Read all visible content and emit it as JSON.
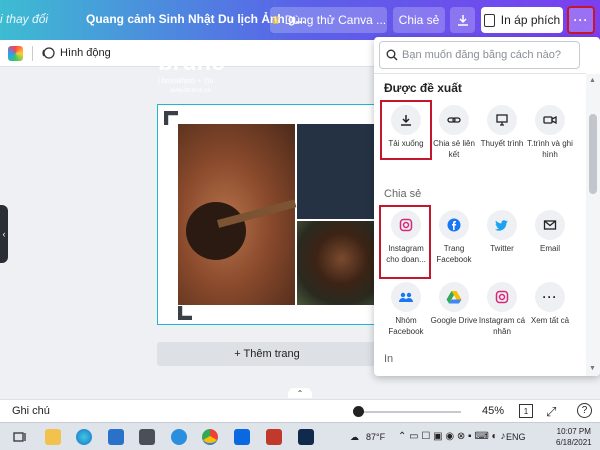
{
  "topbar": {
    "changes_text": "i thay đổi",
    "doc_title": "Quang cảnh Sinh Nhật Du lịch Ảnh g...",
    "trial_label": "Dùng thử Canva ...",
    "share_label": "Chia sẻ",
    "print_label": "In áp phích",
    "more_label": "···"
  },
  "toolbar": {
    "animate_label": "Hình động"
  },
  "design": {
    "brunch_title": "brunc",
    "brunch_sub": "[ br(eakfast) + (l)u",
    "brunch_url": "www.brunch.co"
  },
  "canvas": {
    "add_page_label": "+ Thêm trang"
  },
  "share_panel": {
    "search_placeholder": "Bạn muốn đăng bằng cách nào?",
    "suggested_title": "Được đề xuất",
    "suggested": [
      {
        "label": "Tải xuống",
        "icon": "download-icon"
      },
      {
        "label": "Chia sẻ liên kết",
        "icon": "link-icon"
      },
      {
        "label": "Thuyết trình",
        "icon": "present-icon"
      },
      {
        "label": "T.trình và ghi hình",
        "icon": "video-camera-icon"
      }
    ],
    "share_title": "Chia sẻ",
    "share": [
      {
        "label": "Instagram cho doan...",
        "icon": "instagram-icon"
      },
      {
        "label": "Trang Facebook",
        "icon": "facebook-icon"
      },
      {
        "label": "Twitter",
        "icon": "twitter-icon"
      },
      {
        "label": "Email",
        "icon": "email-icon"
      },
      {
        "label": "Nhóm Facebook",
        "icon": "facebook-group-icon"
      },
      {
        "label": "Google Drive",
        "icon": "google-drive-icon"
      },
      {
        "label": "Instagram cá nhân",
        "icon": "instagram-icon"
      },
      {
        "label": "Xem tất cả",
        "icon": "more-icon"
      }
    ],
    "print_title": "In"
  },
  "bottombar": {
    "notes_label": "Ghi chú",
    "zoom_value": "45%",
    "zoom_fraction": 0.05,
    "page_number": "1",
    "help_label": "?"
  },
  "taskbar": {
    "weather": "87°F",
    "language": "ENG",
    "time": "10:07 PM",
    "date": "6/18/2021"
  },
  "colors": {
    "header_gradient_start": "#3dbcd2",
    "header_gradient_end": "#7b3ff0",
    "highlight": "#c4172c",
    "selection": "#1fb6d0"
  }
}
